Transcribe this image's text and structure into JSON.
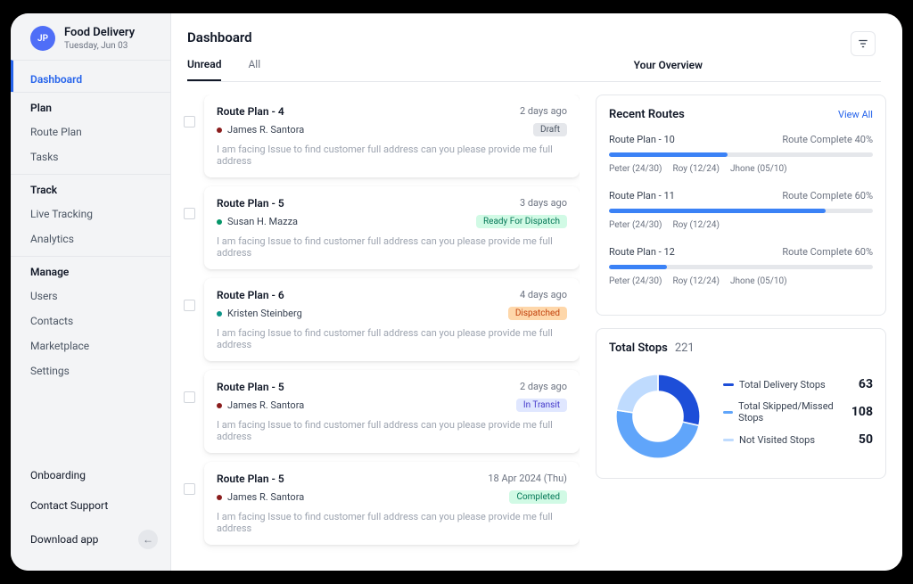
{
  "brand": {
    "initials": "JP",
    "title": "Food Delivery",
    "subtitle": "Tuesday, Jun 03"
  },
  "nav": {
    "dashboard": "Dashboard",
    "plan_head": "Plan",
    "route_plan": "Route Plan",
    "tasks": "Tasks",
    "track_head": "Track",
    "live_tracking": "Live Tracking",
    "analytics": "Analytics",
    "manage_head": "Manage",
    "users": "Users",
    "contacts": "Contacts",
    "marketplace": "Marketplace",
    "settings": "Settings",
    "onboarding": "Onboarding",
    "support": "Contact Support",
    "download": "Download app"
  },
  "header": {
    "page_title": "Dashboard",
    "tab_unread": "Unread",
    "tab_all": "All",
    "overview": "Your Overview"
  },
  "cards": [
    {
      "title": "Route Plan - 4",
      "date": "2 days ago",
      "author": "James R. Santora",
      "dot": "#8b1d1d",
      "badge": "Draft",
      "badge_cls": "b-draft",
      "msg": "I am facing Issue to find customer full address can you please provide me full address"
    },
    {
      "title": "Route Plan - 5",
      "date": "3 days ago",
      "author": "Susan H. Mazza",
      "dot": "#059669",
      "badge": "Ready For Dispatch",
      "badge_cls": "b-ready",
      "msg": "I am facing Issue to find customer full address can you please provide me full address"
    },
    {
      "title": "Route Plan - 6",
      "date": "4 days ago",
      "author": "Kristen Steinberg",
      "dot": "#0d9488",
      "badge": "Dispatched",
      "badge_cls": "b-dispatch",
      "msg": "I am facing Issue to find customer full address can you please provide me full address"
    },
    {
      "title": "Route Plan - 5",
      "date": "2 days ago",
      "author": "James R. Santora",
      "dot": "#8b1d1d",
      "badge": "In Transit",
      "badge_cls": "b-transit",
      "msg": "I am facing Issue to find customer full address can you please provide me full address"
    },
    {
      "title": "Route Plan - 5",
      "date": "18 Apr 2024 (Thu)",
      "author": "James R. Santora",
      "dot": "#8b1d1d",
      "badge": "Completed",
      "badge_cls": "b-complete",
      "msg": "I am facing Issue to find customer full address can you please provide me full address"
    }
  ],
  "recent": {
    "title": "Recent Routes",
    "viewall": "View All",
    "routes": [
      {
        "name": "Route Plan - 10",
        "pct_label": "Route Complete 40%",
        "pct": 45,
        "subs": [
          "Peter (24/30)",
          "Roy (12/24)",
          "Jhone (05/10)"
        ]
      },
      {
        "name": "Route Plan - 11",
        "pct_label": "Route Complete 60%",
        "pct": 82,
        "subs": [
          "Peter (24/30)",
          "Roy (12/24)"
        ]
      },
      {
        "name": "Route Plan - 12",
        "pct_label": "Route Complete 60%",
        "pct": 22,
        "subs": [
          "Peter (24/30)",
          "Roy (12/24)",
          "Jhone (05/10)"
        ]
      }
    ]
  },
  "stops": {
    "title": "Total Stops",
    "total": "221",
    "legend": [
      {
        "label": "Total Delivery Stops",
        "val": "63",
        "color": "#1d4ed8"
      },
      {
        "label": "Total Skipped/Missed Stops",
        "val": "108",
        "color": "#60a5fa"
      },
      {
        "label": "Not Visited Stops",
        "val": "50",
        "color": "#bfdbfe"
      }
    ]
  },
  "chart_data": {
    "type": "pie",
    "title": "Total Stops",
    "total": 221,
    "series": [
      {
        "name": "Total Delivery Stops",
        "value": 63,
        "color": "#1d4ed8"
      },
      {
        "name": "Total Skipped/Missed Stops",
        "value": 108,
        "color": "#60a5fa"
      },
      {
        "name": "Not Visited Stops",
        "value": 50,
        "color": "#bfdbfe"
      }
    ]
  }
}
